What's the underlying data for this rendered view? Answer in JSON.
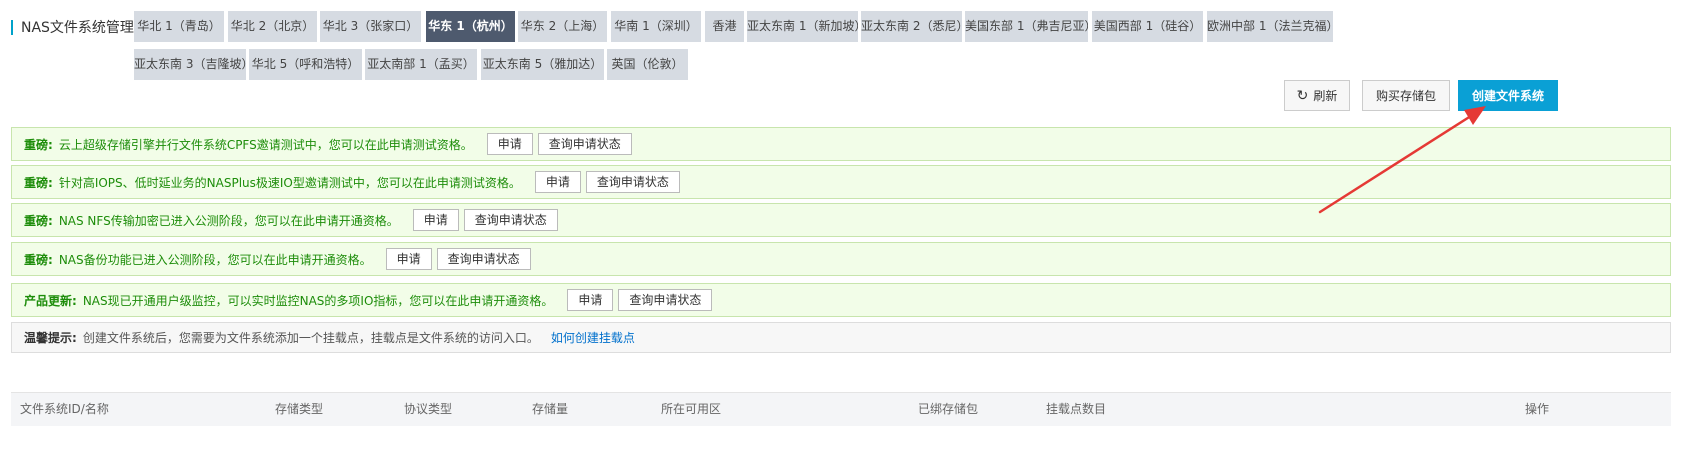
{
  "header": {
    "title": "NAS文件系统管理"
  },
  "regions": [
    {
      "label": "华北 1（青岛）",
      "active": false
    },
    {
      "label": "华北 2（北京）",
      "active": false
    },
    {
      "label": "华北 3（张家口）",
      "active": false
    },
    {
      "label": "华东 1（杭州）",
      "active": true
    },
    {
      "label": "华东 2（上海）",
      "active": false
    },
    {
      "label": "华南 1（深圳）",
      "active": false
    },
    {
      "label": "香港",
      "active": false
    },
    {
      "label": "亚太东南 1（新加坡）",
      "active": false
    },
    {
      "label": "亚太东南 2（悉尼）",
      "active": false
    },
    {
      "label": "美国东部 1（弗吉尼亚）",
      "active": false
    },
    {
      "label": "美国西部 1（硅谷）",
      "active": false
    },
    {
      "label": "欧洲中部 1（法兰克福）",
      "active": false
    },
    {
      "label": "亚太东南 3（吉隆坡）",
      "active": false
    },
    {
      "label": "华北 5（呼和浩特）",
      "active": false
    },
    {
      "label": "亚太南部 1（孟买）",
      "active": false
    },
    {
      "label": "亚太东南 5（雅加达）",
      "active": false
    },
    {
      "label": "英国（伦敦）",
      "active": false
    }
  ],
  "toolbar": {
    "refresh_label": "刷新",
    "buy_label": "购买存储包",
    "create_label": "创建文件系统"
  },
  "notices": [
    {
      "label": "重磅:",
      "message": "云上超级存储引擎并行文件系统CPFS邀请测试中，您可以在此申请测试资格。",
      "apply": "申请",
      "status": "查询申请状态"
    },
    {
      "label": "重磅:",
      "message": "针对高IOPS、低时延业务的NASPlus极速IO型邀请测试中，您可以在此申请测试资格。",
      "apply": "申请",
      "status": "查询申请状态"
    },
    {
      "label": "重磅:",
      "message": "NAS NFS传输加密已进入公测阶段，您可以在此申请开通资格。",
      "apply": "申请",
      "status": "查询申请状态"
    },
    {
      "label": "重磅:",
      "message": "NAS备份功能已进入公测阶段，您可以在此申请开通资格。",
      "apply": "申请",
      "status": "查询申请状态"
    },
    {
      "label": "产品更新:",
      "message": "NAS现已开通用户级监控，可以实时监控NAS的多项IO指标，您可以在此申请开通资格。",
      "apply": "申请",
      "status": "查询申请状态"
    }
  ],
  "tip": {
    "label": "温馨提示:",
    "message": "创建文件系统后，您需要为文件系统添加一个挂载点，挂载点是文件系统的访问入口。",
    "link": "如何创建挂载点"
  },
  "table": {
    "columns": [
      "文件系统ID/名称",
      "存储类型",
      "协议类型",
      "存储量",
      "所在可用区",
      "已绑存储包",
      "挂载点数目",
      "操作"
    ]
  },
  "colors": {
    "accent": "#00a2ca",
    "primary_button": "#0aa0d5",
    "active_tab": "#4e5a6e",
    "tab": "#d6dbe2",
    "notice_bg": "#f2fde8",
    "notice_text": "#1d8d0a",
    "link": "#0070cc",
    "annotation_arrow": "#e53935"
  }
}
